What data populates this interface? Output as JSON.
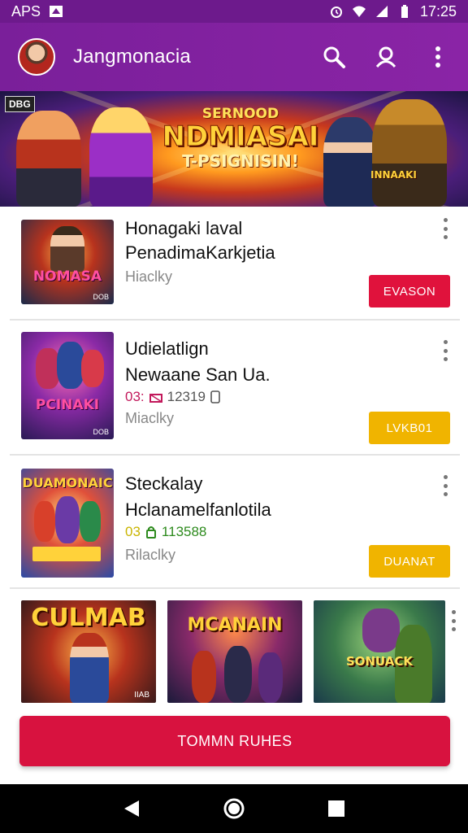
{
  "status_bar": {
    "left_text": "APS",
    "time": "17:25",
    "icons": [
      "notification-icon",
      "alarm-icon",
      "wifi-icon",
      "signal-icon",
      "battery-icon"
    ]
  },
  "app_bar": {
    "title": "Jangmonacia",
    "icons": [
      "search-icon",
      "profile-icon",
      "more-vert-icon"
    ]
  },
  "hero": {
    "logo": "DBG",
    "pretitle": "SERNOOD",
    "title": "NDMIASAI",
    "subtitle": "T-PSIGNISIN!",
    "tag": "INNAAKI"
  },
  "items": [
    {
      "title": "Honagaki laval",
      "subtitle": "PenadimaKarkjetia",
      "meta": "Hiaclky",
      "thumb_label": "NOMASA",
      "thumb_badge": "DOB",
      "button": "EVASON",
      "button_color": "#e0123c"
    },
    {
      "title": "Udielatlign",
      "subtitle": "Newaane San Ua.",
      "stats_prefix": "03:",
      "stats_value": "12319",
      "stats_color": "#c2185b",
      "meta": "Miaclky",
      "thumb_label": "PCINAKI",
      "thumb_badge": "DOB",
      "button": "LVKB01",
      "button_color": "#f0b400"
    },
    {
      "title": "Steckalay",
      "subtitle": "Hclanamelfanlotila",
      "stats_prefix": "03",
      "stats_value": "113588",
      "stats_color": "#2e8b1e",
      "meta": "Rilaclky",
      "thumb_label": "DUAMONAIC",
      "thumb_badge": "",
      "button": "DUANAT",
      "button_color": "#f0b400"
    }
  ],
  "gallery": [
    {
      "label": "CULMAB",
      "badge": "IIAB"
    },
    {
      "label": "MCANAIN",
      "badge": ""
    },
    {
      "label": "SONUACK",
      "badge": ""
    }
  ],
  "cta": {
    "label": "TOMMN RUHES"
  },
  "nav": {
    "icons": [
      "back-icon",
      "home-icon",
      "recents-icon"
    ]
  },
  "colors": {
    "app_bar": "#8a24a6",
    "cta": "#d8123f",
    "button_red": "#e0123c",
    "button_yellow": "#f0b400"
  }
}
